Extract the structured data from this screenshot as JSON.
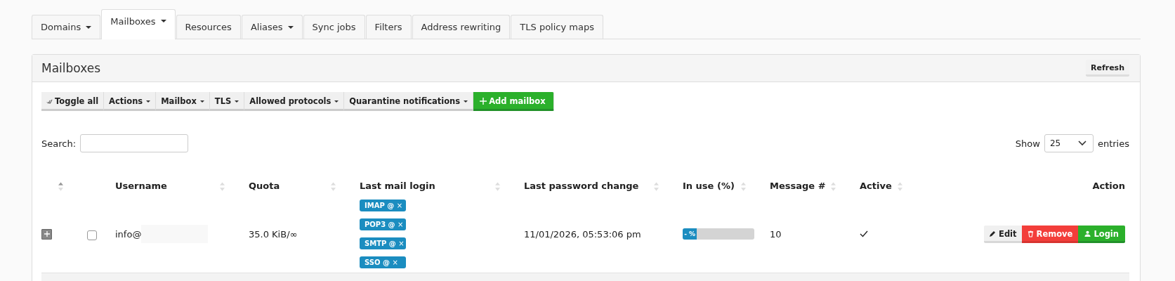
{
  "tabs": [
    {
      "label": "Domains",
      "dropdown": true,
      "selected": false
    },
    {
      "label": "Mailboxes",
      "dropdown": true,
      "selected": true
    },
    {
      "label": "Resources",
      "dropdown": false,
      "selected": false
    },
    {
      "label": "Aliases",
      "dropdown": true,
      "selected": false
    },
    {
      "label": "Sync jobs",
      "dropdown": false,
      "selected": false
    },
    {
      "label": "Filters",
      "dropdown": false,
      "selected": false
    },
    {
      "label": "Address rewriting",
      "dropdown": false,
      "selected": false
    },
    {
      "label": "TLS policy maps",
      "dropdown": false,
      "selected": false
    }
  ],
  "panel": {
    "title": "Mailboxes",
    "refresh_button": "Refresh",
    "toolbar": [
      {
        "label": "Toggle all",
        "kind": "toggle"
      },
      {
        "label": "Actions",
        "kind": "dropdown"
      },
      {
        "label": "Mailbox",
        "kind": "dropdown"
      },
      {
        "label": "TLS",
        "kind": "dropdown"
      },
      {
        "label": "Allowed protocols",
        "kind": "dropdown"
      },
      {
        "label": "Quarantine notifications",
        "kind": "dropdown"
      },
      {
        "label": "Add mailbox",
        "kind": "add"
      }
    ],
    "search": {
      "label": "Search:"
    },
    "length": {
      "before": "Show",
      "value": "25",
      "after": "entries"
    },
    "table": {
      "columns": [
        {
          "sortable": true
        },
        {
          "label": "Username",
          "sortable": true
        },
        {
          "label": "Quota",
          "sortable": true
        },
        {
          "label": "Last mail login",
          "sortable": true
        },
        {
          "label": "Last password change",
          "sortable": true
        },
        {
          "label": "In use (%)",
          "sortable": true
        },
        {
          "label": "Message #",
          "sortable": true
        },
        {
          "label": "Active",
          "sortable": true
        },
        {
          "label": "Action",
          "sortable": false
        }
      ],
      "rows": [
        {
          "checked": false,
          "username": "info@",
          "quota": "35.0 KiB/∞",
          "logins": [
            {
              "label": "IMAP @",
              "remove": "×"
            },
            {
              "label": "POP3 @",
              "remove": "×"
            },
            {
              "label": "SMTP @",
              "remove": "×"
            },
            {
              "label": "SSO @",
              "remove": "×"
            }
          ],
          "password_change": "11/01/2026, 05:53:06 pm",
          "usage": {
            "level": 0.2,
            "label": "- %"
          },
          "messages": "10",
          "active": true,
          "actions": [
            {
              "label": "Edit",
              "kind": "edit"
            },
            {
              "label": "Remove",
              "kind": "remove"
            },
            {
              "label": "Login",
              "kind": "login"
            }
          ]
        }
      ]
    }
  }
}
